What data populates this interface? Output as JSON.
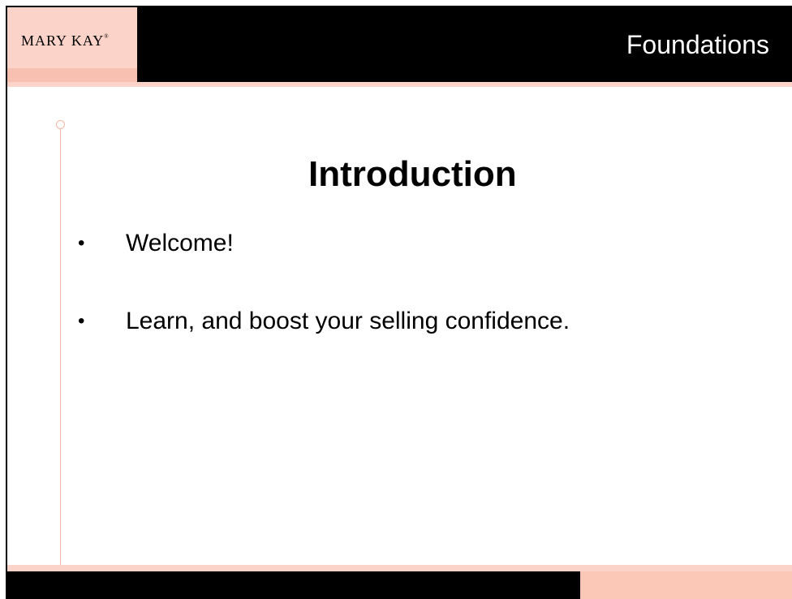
{
  "header": {
    "logo_text": "MARY KAY",
    "logo_mark": "®",
    "title": "Foundations"
  },
  "slide": {
    "title": "Introduction",
    "bullets": [
      "Welcome!",
      "Learn, and boost your selling confidence."
    ],
    "bullet_glyph": "•"
  },
  "colors": {
    "header_background": "#000000",
    "accent_pink": "#fbd3c8",
    "accent_pink_dark": "#f8c0b0",
    "decorative_line": "#f2b8a8",
    "text": "#000000",
    "header_text": "#ffffff"
  }
}
